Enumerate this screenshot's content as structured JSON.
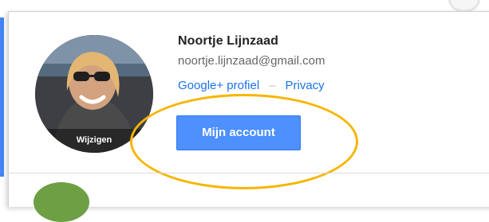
{
  "account_popup": {
    "avatar_edit_label": "Wijzigen",
    "user_name": "Noortje Lijnzaad",
    "user_email": "noortje.lijnzaad@gmail.com",
    "google_plus_label": "Google+ profiel",
    "separator": "–",
    "privacy_label": "Privacy",
    "account_button_label": "Mijn account"
  },
  "colors": {
    "accent_blue": "#4285f4",
    "button_blue": "#4d90fe",
    "link_blue": "#1a73e8",
    "highlight_ellipse": "#f7b500",
    "next_avatar_green": "#6d9f43"
  },
  "icons": {
    "avatar": "profile-photo",
    "next_account": "account-avatar"
  }
}
